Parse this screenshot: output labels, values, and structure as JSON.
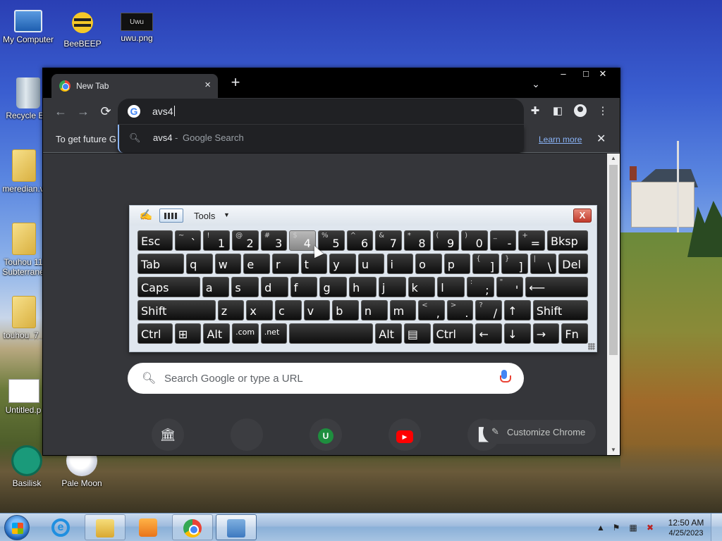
{
  "desktop": {
    "icons": [
      {
        "label": "My Computer",
        "icon": "computer-icon"
      },
      {
        "label": "BeeBEEP",
        "icon": "bee-icon"
      },
      {
        "label": "uwu.png",
        "icon": "image-file-icon",
        "thumb_text": "Uwu"
      },
      {
        "label": "Recycle Bin",
        "icon": "recycle-bin-icon"
      },
      {
        "label": "meredian.v",
        "icon": "folder-icon"
      },
      {
        "label": "Touhou 11 Subterrane",
        "icon": "folder-icon"
      },
      {
        "label": "touhou_7_",
        "icon": "folder-icon"
      },
      {
        "label": "Untitled.p",
        "icon": "image-file-icon"
      },
      {
        "label": "Basilisk",
        "icon": "basilisk-icon"
      },
      {
        "label": "Pale Moon",
        "icon": "pale-moon-icon"
      }
    ]
  },
  "browser": {
    "tab": {
      "title": "New Tab",
      "close": "×"
    },
    "new_tab": "+",
    "tab_search": "⌄",
    "window_controls": {
      "minimize": "–",
      "maximize": "□",
      "close": "✕"
    },
    "nav": {
      "back": "←",
      "forward": "→",
      "reload": "⟳"
    },
    "omnibox": {
      "g_logo": "G",
      "value": "avs4"
    },
    "suggestion": {
      "query": "avs4",
      "separator": "-",
      "engine": "Google Search"
    },
    "infobar": {
      "text": "To get future G",
      "link": "Learn more",
      "close": "✕"
    },
    "toolbar_icons": {
      "extensions": "puzzle-icon",
      "side_panel": "side-panel-icon",
      "profile": "profile-icon",
      "menu": "⋮"
    },
    "ntp": {
      "search_placeholder": "Search Google or type a URL",
      "shortcuts": [
        {
          "icon": "museum-icon",
          "glyph": "🏛"
        },
        {
          "icon": "blank-shortcut-icon",
          "glyph": ""
        },
        {
          "icon": "u-avatar-icon",
          "glyph": "U"
        },
        {
          "icon": "youtube-icon",
          "glyph": "▶"
        },
        {
          "icon": "shortcut-icon",
          "glyph": "▙"
        }
      ],
      "customize_label": "Customize Chrome"
    }
  },
  "osk": {
    "tools_label": "Tools",
    "close_label": "X",
    "pressed_key": "4",
    "rows": [
      [
        {
          "main": "Esc",
          "w": 1.3
        },
        {
          "main": "`",
          "shift": "~"
        },
        {
          "main": "1",
          "shift": "!"
        },
        {
          "main": "2",
          "shift": "@"
        },
        {
          "main": "3",
          "shift": "#"
        },
        {
          "main": "4",
          "shift": "$"
        },
        {
          "main": "5",
          "shift": "%"
        },
        {
          "main": "6",
          "shift": "^"
        },
        {
          "main": "7",
          "shift": "&"
        },
        {
          "main": "8",
          "shift": "*"
        },
        {
          "main": "9",
          "shift": "("
        },
        {
          "main": "0",
          "shift": ")"
        },
        {
          "main": "-",
          "shift": "_"
        },
        {
          "main": "=",
          "shift": "+"
        },
        {
          "main": "Bksp",
          "w": 1.5
        }
      ],
      [
        {
          "main": "Tab",
          "w": 1.7
        },
        {
          "main": "q"
        },
        {
          "main": "w"
        },
        {
          "main": "e"
        },
        {
          "main": "r"
        },
        {
          "main": "t"
        },
        {
          "main": "y"
        },
        {
          "main": "u"
        },
        {
          "main": "i"
        },
        {
          "main": "o"
        },
        {
          "main": "p"
        },
        {
          "main": "]",
          "shift": "{"
        },
        {
          "main": "]",
          "shift": "}"
        },
        {
          "main": "\\",
          "shift": "|"
        },
        {
          "main": "Del",
          "w": 1.1
        }
      ],
      [
        {
          "main": "Caps",
          "w": 2.2
        },
        {
          "main": "a"
        },
        {
          "main": "s"
        },
        {
          "main": "d"
        },
        {
          "main": "f"
        },
        {
          "main": "g"
        },
        {
          "main": "h"
        },
        {
          "main": "j"
        },
        {
          "main": "k"
        },
        {
          "main": "l"
        },
        {
          "main": ";",
          "shift": ":"
        },
        {
          "main": "'",
          "shift": "\""
        },
        {
          "main": "⟵",
          "w": 2.2
        }
      ],
      [
        {
          "main": "Shift",
          "w": 2.8
        },
        {
          "main": "z"
        },
        {
          "main": "x"
        },
        {
          "main": "c"
        },
        {
          "main": "v"
        },
        {
          "main": "b"
        },
        {
          "main": "n"
        },
        {
          "main": "m"
        },
        {
          "main": ",",
          "shift": "<"
        },
        {
          "main": ".",
          "shift": ">"
        },
        {
          "main": "/",
          "shift": "?"
        },
        {
          "main": "↑"
        },
        {
          "main": "Shift",
          "w": 2.0
        }
      ],
      [
        {
          "main": "Ctrl",
          "w": 1.3
        },
        {
          "main": "⊞"
        },
        {
          "main": "Alt"
        },
        {
          "main": ".com",
          "small": true
        },
        {
          "main": ".net",
          "small": true
        },
        {
          "main": "",
          "w": 3.0
        },
        {
          "main": "Alt"
        },
        {
          "main": "▤"
        },
        {
          "main": "Ctrl",
          "w": 1.5
        },
        {
          "main": "←"
        },
        {
          "main": "↓"
        },
        {
          "main": "→"
        },
        {
          "main": "Fn"
        }
      ]
    ]
  },
  "taskbar": {
    "clock_time": "12:50 AM",
    "clock_date": "4/25/2023",
    "tray": {
      "up": "▲",
      "flag": "⚑",
      "network": "▦",
      "volume": "✖"
    }
  }
}
